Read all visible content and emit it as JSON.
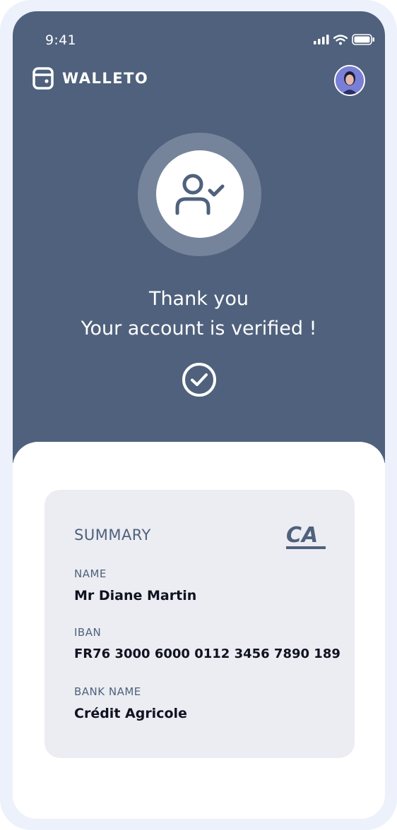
{
  "status_bar": {
    "time": "9:41"
  },
  "brand": {
    "name": "WALLETO"
  },
  "hero": {
    "thank_you": "Thank you",
    "verified_message": "Your account is verified !"
  },
  "summary": {
    "title": "SUMMARY",
    "name_label": "NAME",
    "name_value": "Mr Diane Martin",
    "iban_label": "IBAN",
    "iban_value": "FR76 3000 6000 0112 3456 7890 189",
    "bank_label": "BANK NAME",
    "bank_value": "Crédit Agricole",
    "bank_logo_text": "CA"
  },
  "colors": {
    "hero_bg": "#4f617c",
    "card_bg": "#ecedf2",
    "accent_text": "#4f617c",
    "value_text": "#0f1220"
  },
  "icons": [
    "signal-icon",
    "wifi-icon",
    "battery-icon",
    "wallet-logo-icon",
    "user-verified-icon",
    "check-circle-icon",
    "bank-logo-icon"
  ]
}
